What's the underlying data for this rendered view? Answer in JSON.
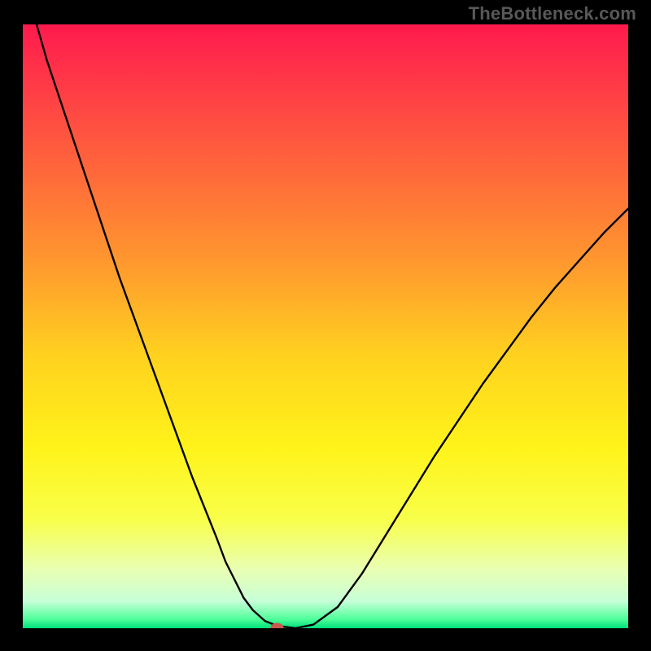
{
  "watermark": "TheBottleneck.com",
  "colors": {
    "frame": "#000000",
    "curve": "#000000",
    "marker": "#c85a4f",
    "gradient_stops": [
      {
        "offset": 0.0,
        "color": "#ff1a4d"
      },
      {
        "offset": 0.1,
        "color": "#ff3a47"
      },
      {
        "offset": 0.25,
        "color": "#ff6a3a"
      },
      {
        "offset": 0.4,
        "color": "#ff9a2e"
      },
      {
        "offset": 0.55,
        "color": "#ffd21f"
      },
      {
        "offset": 0.7,
        "color": "#fff31a"
      },
      {
        "offset": 0.82,
        "color": "#f8ff4a"
      },
      {
        "offset": 0.9,
        "color": "#eaffb0"
      },
      {
        "offset": 0.955,
        "color": "#c8ffd8"
      },
      {
        "offset": 0.985,
        "color": "#4fff9a"
      },
      {
        "offset": 1.0,
        "color": "#00e07a"
      }
    ]
  },
  "chart_data": {
    "type": "line",
    "title": "",
    "xlabel": "",
    "ylabel": "",
    "xlim": [
      0,
      100
    ],
    "ylim": [
      0,
      100
    ],
    "grid": false,
    "legend": false,
    "series": [
      {
        "name": "bottleneck-curve",
        "x": [
          0,
          2,
          4,
          6,
          8,
          10,
          12,
          14,
          16,
          18,
          20,
          22,
          24,
          26,
          28,
          30,
          32,
          33.5,
          35,
          36.5,
          38,
          40,
          42,
          45,
          48,
          52,
          56,
          60,
          64,
          68,
          72,
          76,
          80,
          84,
          88,
          92,
          96,
          100
        ],
        "y": [
          108,
          101,
          94,
          88,
          82,
          76,
          70,
          64,
          58,
          52.5,
          47,
          41.5,
          36,
          30.5,
          25,
          20,
          15,
          11,
          8,
          5,
          3,
          1.2,
          0.4,
          0,
          0.6,
          3.5,
          9,
          15.5,
          22,
          28.5,
          34.5,
          40.5,
          46,
          51.5,
          56.5,
          61,
          65.5,
          69.5
        ]
      }
    ],
    "flat_bottom": {
      "x_start": 38,
      "x_end": 45,
      "y": 0
    },
    "marker": {
      "x": 42,
      "y": 0,
      "rx": 1.1,
      "ry": 0.9
    }
  }
}
